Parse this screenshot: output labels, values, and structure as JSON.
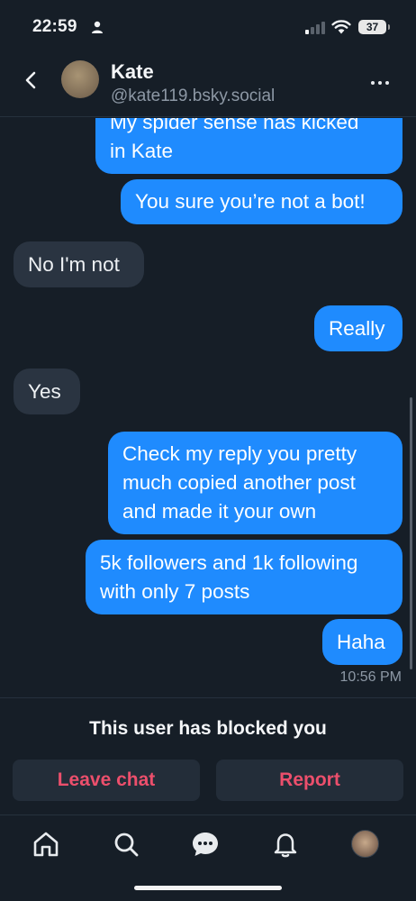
{
  "status_bar": {
    "time": "22:59",
    "battery": "37"
  },
  "header": {
    "name": "Kate",
    "handle": "@kate119.bsky.social"
  },
  "messages": [
    {
      "from": "me",
      "lines": [
        "My spider sense has kicked",
        "in Kate"
      ]
    },
    {
      "from": "me",
      "lines": [
        "You sure you’re not a bot!"
      ]
    },
    {
      "from": "them",
      "lines": [
        "No I'm not"
      ]
    },
    {
      "from": "me",
      "lines": [
        "Really"
      ]
    },
    {
      "from": "them",
      "lines": [
        "Yes"
      ]
    },
    {
      "from": "me",
      "lines": [
        "Check my reply you pretty",
        "much copied another post",
        "and made it your own"
      ]
    },
    {
      "from": "me",
      "lines": [
        "5k followers and 1k following",
        "with only 7 posts"
      ]
    },
    {
      "from": "me",
      "lines": [
        "Haha"
      ]
    }
  ],
  "last_message_time": "10:56 PM",
  "blocked": {
    "notice": "This user has blocked you",
    "leave_label": "Leave chat",
    "report_label": "Report"
  },
  "tabs": [
    {
      "icon": "home-icon"
    },
    {
      "icon": "search-icon"
    },
    {
      "icon": "chat-bubble-icon",
      "active": true
    },
    {
      "icon": "bell-icon"
    },
    {
      "icon": "profile-avatar"
    }
  ],
  "colors": {
    "background": "#161e27",
    "sent_bubble": "#1f8bfe",
    "received_bubble": "#2a3441",
    "destructive": "#ec4f6c",
    "secondary_text": "#8d98a5"
  }
}
